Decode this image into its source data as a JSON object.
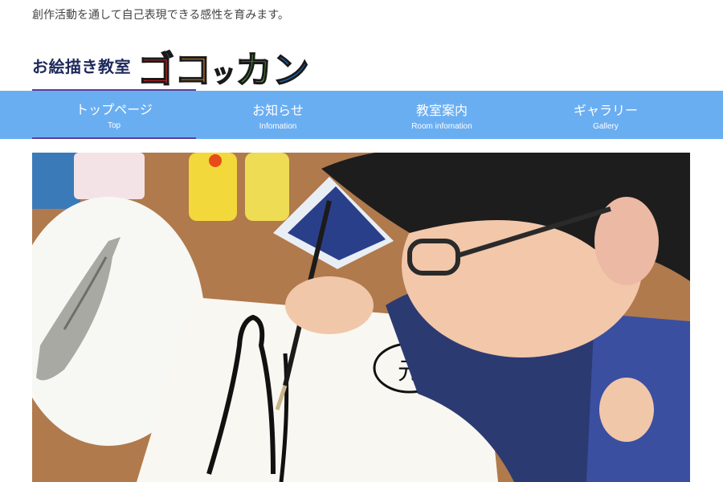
{
  "header": {
    "tagline": "創作活動を通して自己表現できる感性を育みます。",
    "logo": {
      "prefix": "お絵描き教室",
      "chars": [
        {
          "text": "ゴ",
          "color": "#e8262c",
          "size": "big"
        },
        {
          "text": "コ",
          "color": "#f39a1a",
          "size": "big"
        },
        {
          "text": "ッ",
          "color": "#f6c614",
          "size": "small"
        },
        {
          "text": "カ",
          "color": "#52b52f",
          "size": "big"
        },
        {
          "text": "ン",
          "color": "#1e78d8",
          "size": "big"
        }
      ]
    }
  },
  "nav": {
    "items": [
      {
        "label": "トップページ",
        "sub": "Top",
        "active": true
      },
      {
        "label": "お知らせ",
        "sub": "Infomation",
        "active": false
      },
      {
        "label": "教室案内",
        "sub": "Room infomation",
        "active": false
      },
      {
        "label": "ギャラリー",
        "sub": "Gallery",
        "active": false
      }
    ]
  },
  "hero": {
    "drawing_text": "元"
  },
  "colors": {
    "nav_bg": "#6aaef2",
    "nav_active_rule": "#5a3f96",
    "logo_prefix": "#1f2a5c"
  }
}
